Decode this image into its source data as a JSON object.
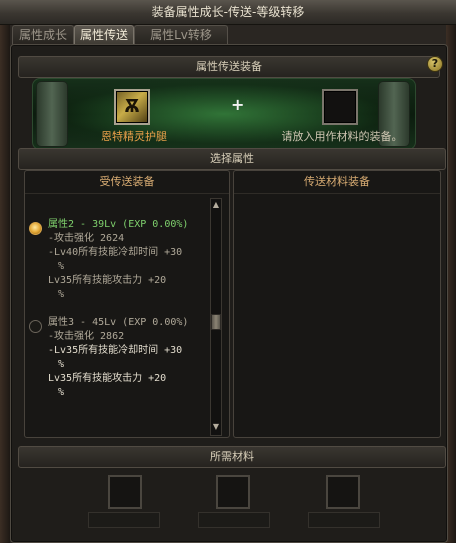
{
  "window": {
    "title": "装备属性成长-传送-等级转移"
  },
  "tabs": [
    {
      "label": "属性成长",
      "active": false
    },
    {
      "label": "属性传送",
      "active": true
    },
    {
      "label": "属性Lv转移",
      "active": false
    }
  ],
  "transfer": {
    "header": "属性传送装备",
    "help_label": "?",
    "source_item_name": "恩特精灵护腿",
    "source_icon": "ent-elf-legs-icon",
    "target_hint": "请放入用作材料的装备。",
    "plus": "+"
  },
  "selection": {
    "header": "选择属性",
    "left_panel_title": "受传送装备",
    "right_panel_title": "传送材料装备",
    "options": [
      {
        "selected": true,
        "title": "属性2 - 39Lv (EXP 0.00%)",
        "lines": [
          {
            "text": "-攻击强化 2624",
            "color": "gr"
          },
          {
            "text": "-Lv40所有技能冷却时间 +30",
            "color": "gr"
          },
          {
            "text": "%",
            "color": "gr"
          },
          {
            "text": " Lv35所有技能攻击力 +20",
            "color": "gr"
          },
          {
            "text": "%",
            "color": "gr"
          }
        ]
      },
      {
        "selected": false,
        "title": "属性3 - 45Lv (EXP 0.00%)",
        "lines": [
          {
            "text": "-攻击强化 2862",
            "color": "b"
          },
          {
            "text": "-Lv35所有技能冷却时间 +30",
            "color": "w"
          },
          {
            "text": "%",
            "color": "w"
          },
          {
            "text": " Lv35所有技能攻击力 +20",
            "color": "w"
          },
          {
            "text": "%",
            "color": "w"
          }
        ]
      }
    ]
  },
  "materials": {
    "header": "所需材料"
  }
}
